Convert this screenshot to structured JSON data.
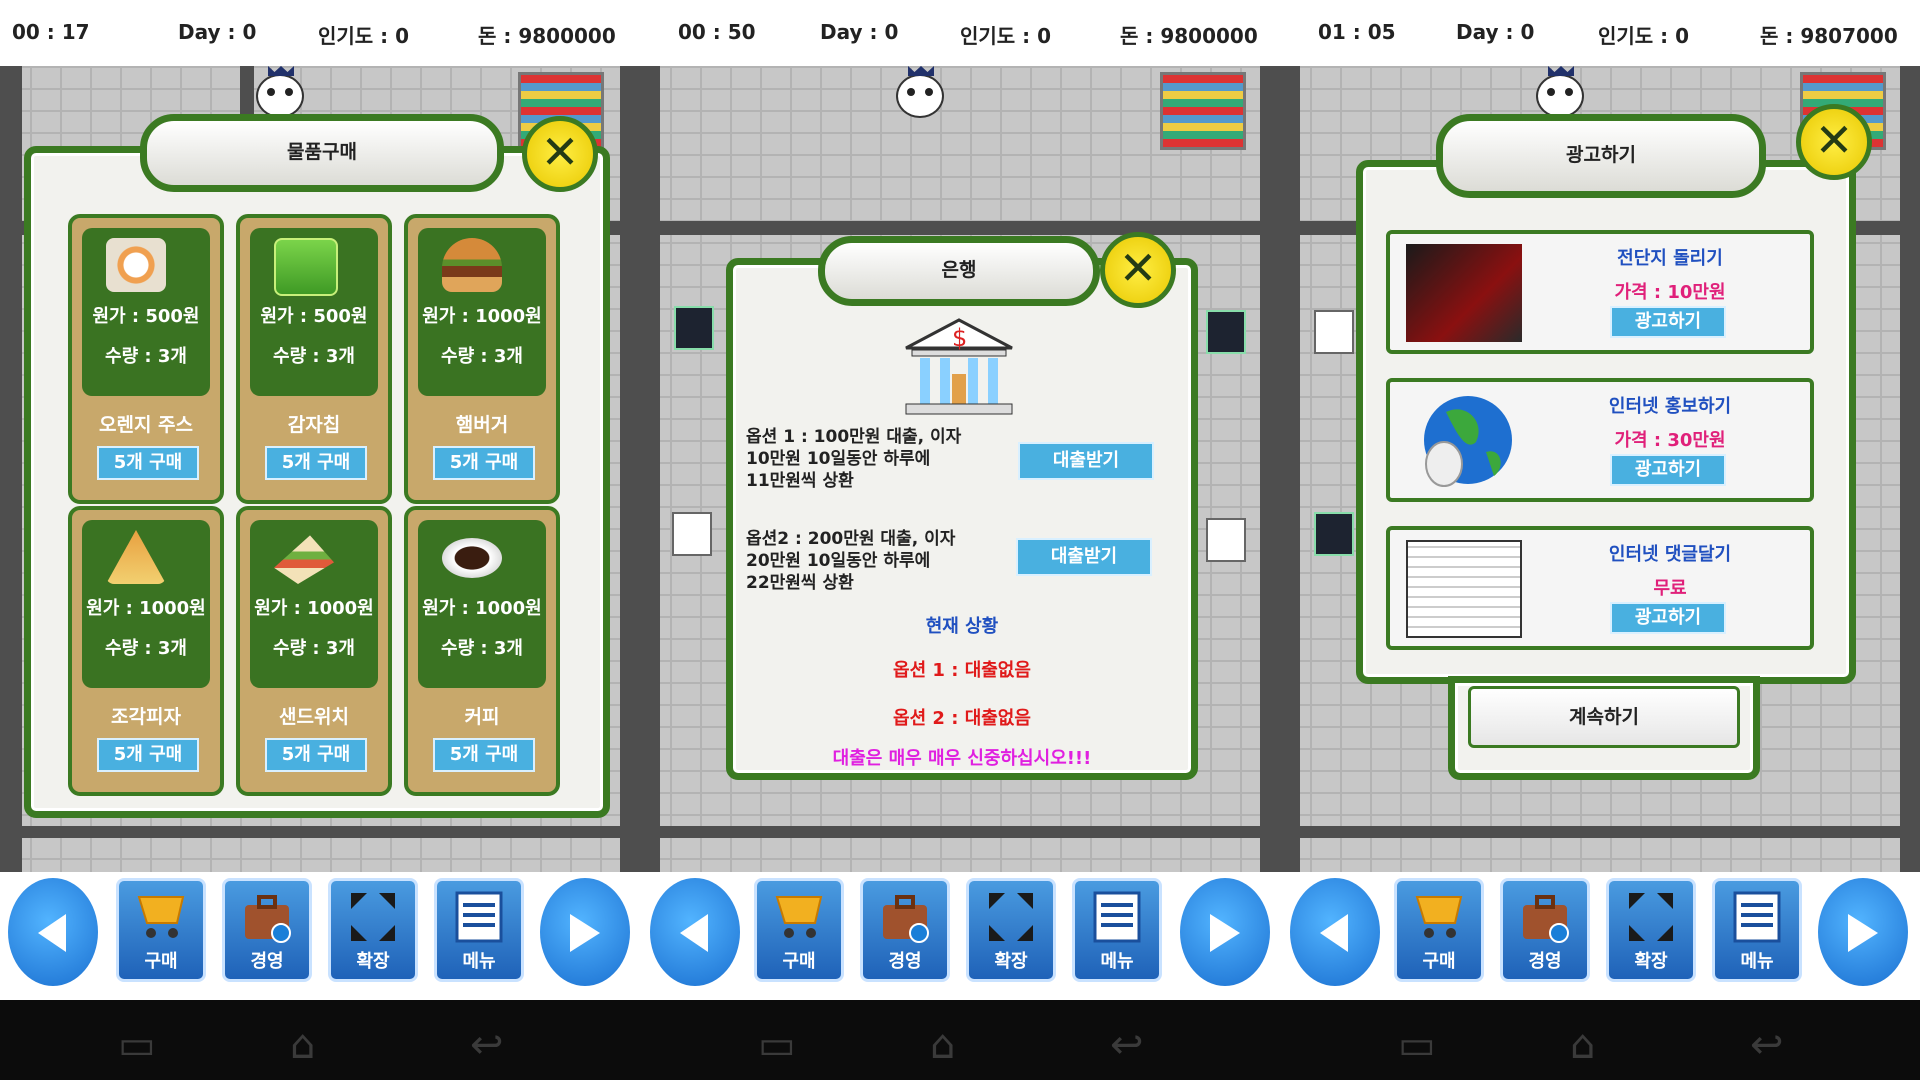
{
  "screens": [
    {
      "status": {
        "time": "00 : 17",
        "day": "Day : 0",
        "popularity": "인기도 : 0",
        "money": "돈 : 9800000"
      },
      "panel": {
        "title": "물품구매",
        "items": [
          {
            "cost": "원가 : 500원",
            "qty": "수량 : 3개",
            "name": "오렌지 주스",
            "buy": "5개 구매",
            "icon": "juice-icon"
          },
          {
            "cost": "원가 : 500원",
            "qty": "수량 : 3개",
            "name": "감자칩",
            "buy": "5개 구매",
            "icon": "chips-icon"
          },
          {
            "cost": "원가 : 1000원",
            "qty": "수량 : 3개",
            "name": "햄버거",
            "buy": "5개 구매",
            "icon": "hamburger-icon"
          },
          {
            "cost": "원가 : 1000원",
            "qty": "수량 : 3개",
            "name": "조각피자",
            "buy": "5개 구매",
            "icon": "pizza-icon"
          },
          {
            "cost": "원가 : 1000원",
            "qty": "수량 : 3개",
            "name": "샌드위치",
            "buy": "5개 구매",
            "icon": "sandwich-icon"
          },
          {
            "cost": "원가 : 1000원",
            "qty": "수량 : 3개",
            "name": "커피",
            "buy": "5개 구매",
            "icon": "coffee-icon"
          }
        ]
      }
    },
    {
      "status": {
        "time": "00 : 50",
        "day": "Day : 0",
        "popularity": "인기도 : 0",
        "money": "돈 : 9800000"
      },
      "panel": {
        "title": "은행",
        "option1": [
          "옵션 1 : 100만원 대출, 이자",
          "10만원 10일동안 하루에",
          "11만원씩 상환"
        ],
        "option2": [
          "옵션2 : 200만원 대출, 이자",
          "20만원 10일동안 하루에",
          "22만원씩 상환"
        ],
        "loan_label": "대출받기",
        "current_status": "현재 상황",
        "status1": "옵션 1 : 대출없음",
        "status2": "옵션 2 : 대출없음",
        "warning": "대출은 매우 매우 신중하십시오!!!"
      }
    },
    {
      "status": {
        "time": "01 : 05",
        "day": "Day : 0",
        "popularity": "인기도 : 0",
        "money": "돈 : 9807000"
      },
      "panel": {
        "title": "광고하기",
        "ads": [
          {
            "title": "전단지 돌리기",
            "price": "가격 : 10만원",
            "button": "광고하기",
            "icon": "flyer-icon"
          },
          {
            "title": "인터넷 홍보하기",
            "price": "가격 : 30만원",
            "button": "광고하기",
            "icon": "globe-mouse-icon"
          },
          {
            "title": "인터넷 댓글달기",
            "price": "무료",
            "button": "광고하기",
            "icon": "webpage-icon"
          }
        ],
        "continue_label": "계속하기"
      }
    }
  ],
  "toolbar": {
    "buy": "구매",
    "manage": "경영",
    "expand": "확장",
    "menu": "메뉴"
  },
  "colors": {
    "panel_border": "#3b7a22",
    "button_blue": "#49b0e0",
    "link_blue": "#2050c0",
    "price_pink": "#e0207a",
    "warning_magenta": "#e020e0",
    "status_red": "#e01a1a"
  }
}
